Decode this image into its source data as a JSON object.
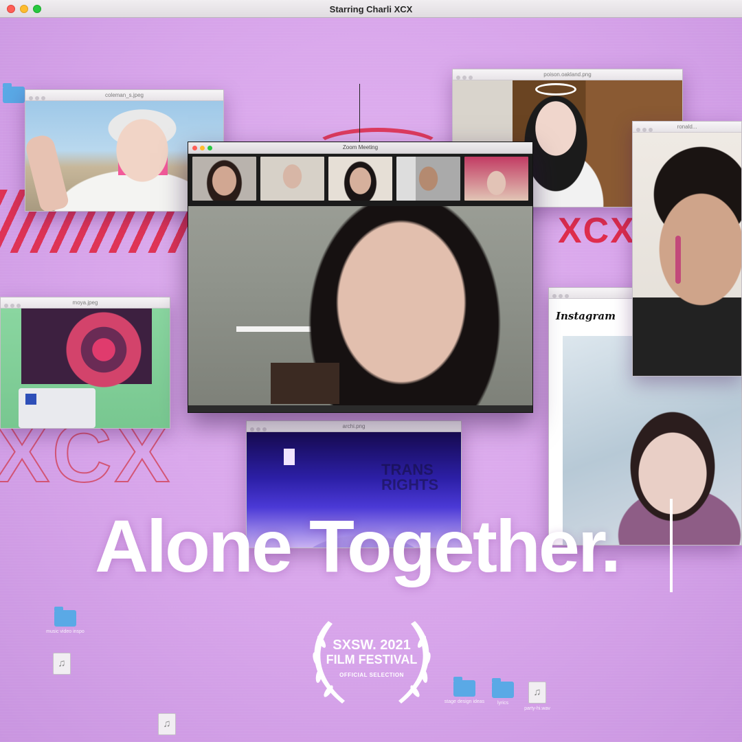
{
  "window": {
    "title": "Starring Charli XCX"
  },
  "windows": {
    "coleman": {
      "title": "coleman_s.jpeg"
    },
    "poison": {
      "title": "poison.oakland.png"
    },
    "ronald": {
      "title": "ronald..."
    },
    "moya": {
      "title": "moya.jpeg"
    },
    "archi": {
      "title": "archi.png"
    },
    "zoom": {
      "title": "Zoom Meeting"
    },
    "instagram": {
      "logo": "Instagram"
    }
  },
  "headline": "Alone Together.",
  "laurel": {
    "line1": "SXSW. 2021",
    "line2": "FILM FESTIVAL",
    "line3": "OFFICIAL SELECTION"
  },
  "decor": {
    "xcx": "XCX"
  },
  "desktop_icons": [
    {
      "type": "folder",
      "label": ""
    },
    {
      "type": "folder",
      "label": "music video inspo"
    },
    {
      "type": "audio",
      "label": ""
    },
    {
      "type": "folder",
      "label": "stage design ideas"
    },
    {
      "type": "folder",
      "label": "lyrics"
    },
    {
      "type": "audio",
      "label": "party-hi.wav"
    },
    {
      "type": "audio",
      "label": ""
    }
  ],
  "colors": {
    "accent_red": "#e0203c",
    "background": "#d6a6e8",
    "folder": "#5aa9e6"
  }
}
